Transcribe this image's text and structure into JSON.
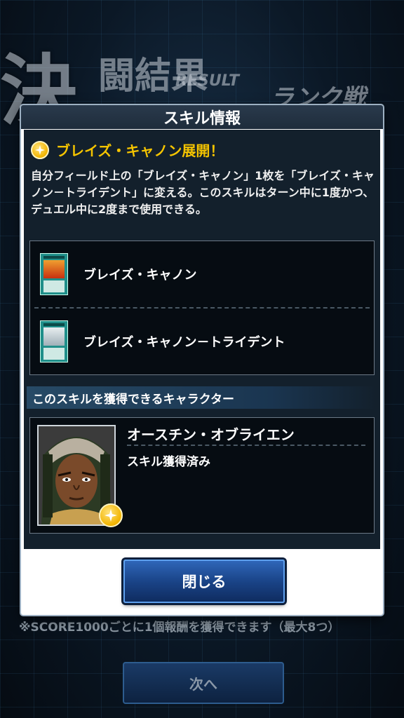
{
  "background": {
    "title_big": "決",
    "title_rest": "闘結果",
    "result_label": "RESULT",
    "rank_label": "ランク戦",
    "score_note": "※SCORE1000ごとに1個報酬を獲得できます（最大8つ）",
    "next_label": "次へ"
  },
  "modal": {
    "header": "スキル情報",
    "skill": {
      "icon": "star-icon",
      "title": "ブレイズ・キャノン展開！",
      "description": "自分フィールド上の「ブレイズ・キャノン」1枚を「ブレイズ・キャノン－トライデント」に変える。このスキルはターン中に1度かつ、デュエル中に2度まで使用できる。"
    },
    "cards": [
      {
        "name": "ブレイズ・キャノン",
        "art": "fire"
      },
      {
        "name": "ブレイズ・キャノン－トライデント",
        "art": "ice"
      }
    ],
    "character_section_title": "このスキルを獲得できるキャラクター",
    "character": {
      "name": "オースチン・オブライエン",
      "status": "スキル獲得済み"
    },
    "close_label": "閉じる"
  },
  "colors": {
    "skill_title": "#f5c400",
    "button": "#1a4488",
    "panel": "#13202c"
  }
}
